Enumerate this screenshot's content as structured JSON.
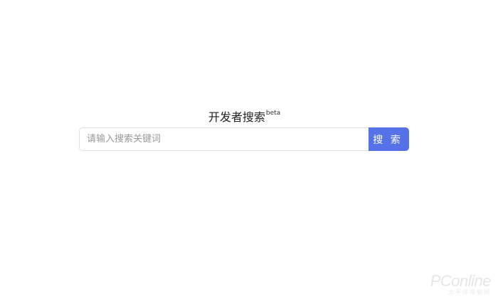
{
  "header": {
    "title": "开发者搜索",
    "badge": "beta"
  },
  "search": {
    "placeholder": "请输入搜索关键词",
    "value": "",
    "button_label": "搜 索"
  },
  "watermark": {
    "logo": "PConline",
    "subtitle": "太平洋电脑网"
  },
  "colors": {
    "accent": "#5572e9",
    "input_border": "#dcdfe6",
    "background": "#ffffff"
  }
}
